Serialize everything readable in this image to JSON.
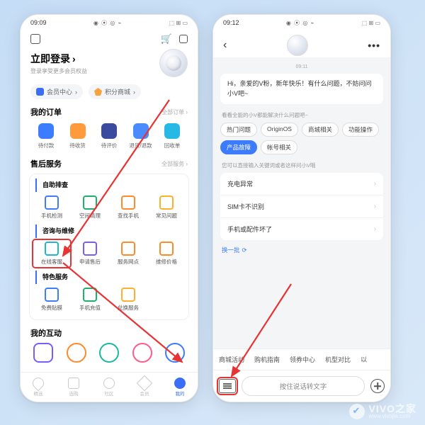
{
  "left": {
    "status": {
      "time": "09:09",
      "icons": "◉ ⦿ ◎ ⌁",
      "right": "⬚ ⊞ ▭"
    },
    "login": {
      "title": "立即登录",
      "subtitle": "登录享受更多会员权益"
    },
    "chips": {
      "member": "会员中心",
      "points": "积分商城"
    },
    "orders": {
      "title": "我的订单",
      "more": "全部订单 ›",
      "items": [
        "待付款",
        "待收货",
        "待评价",
        "退货/退款",
        "回收单"
      ]
    },
    "service": {
      "title": "售后服务",
      "more": "全部服务 ›",
      "self": {
        "title": "自助排查",
        "items": [
          "手机检测",
          "空间清理",
          "查找手机",
          "常见问题"
        ]
      },
      "consult": {
        "title": "咨询与维修",
        "items": [
          "在线客服",
          "申请售后",
          "服务网点",
          "维修价格"
        ]
      },
      "special": {
        "title": "特色服务",
        "items": [
          "免费贴膜",
          "手机充值",
          "兑换服务"
        ]
      }
    },
    "interact": {
      "title": "我的互动"
    },
    "nav": [
      "精选",
      "选购",
      "社区",
      "会员",
      "我的"
    ]
  },
  "right": {
    "status": {
      "time": "09:12",
      "icons": "◉ ⦿ ◎ ⌁",
      "right": "⬚ ⊞ ▭"
    },
    "tstamp": "09:11",
    "greeting": "Hi，亲爱的V粉，新年快乐！有什么问题，不妨问问小V吧~",
    "hint1": "看看全能的小V都能解决什么问题吧~",
    "tags": [
      "热门问题",
      "OriginOS",
      "商城相关",
      "功能操作",
      "产品故障",
      "帐号相关"
    ],
    "active_tag_index": 4,
    "hint2": "您可以直接输入关键词或者这样问小V哦",
    "faq": [
      "充电异常",
      "SIM卡不识别",
      "手机或配件坏了"
    ],
    "swap": "换一批",
    "quick": [
      "商城活动",
      "购机指南",
      "领券中心",
      "机型对比",
      "以"
    ],
    "voice": "按住说话转文字"
  },
  "watermark": {
    "brand": "VIVO之家",
    "url": "www.vivojia.com"
  }
}
